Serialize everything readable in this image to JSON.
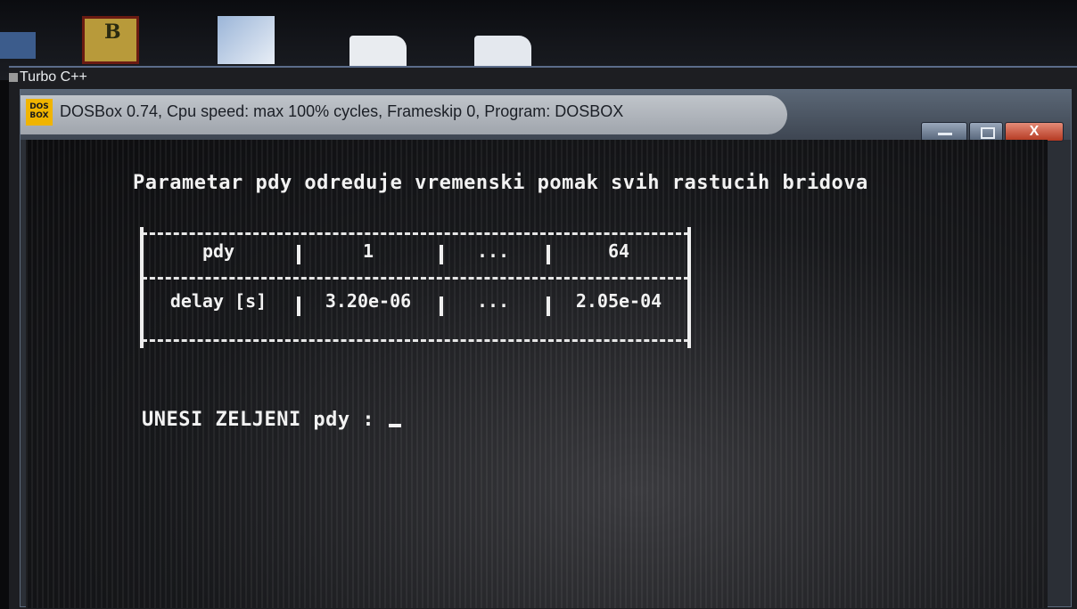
{
  "desktop": {
    "icons": [
      "game-icon",
      "image-icon",
      "document-icon",
      "document-icon"
    ]
  },
  "background_window": {
    "title": "Turbo C++"
  },
  "dosbox_window": {
    "title": "DOSBox 0.74, Cpu speed: max 100% cycles, Frameskip 0, Program:  DOSBOX",
    "icon_text": "DOS\nBOX",
    "close_label": "X"
  },
  "screen": {
    "heading": "Parametar pdy odreduje vremenski pomak svih rastucih bridova",
    "table": {
      "header": [
        "pdy",
        "1",
        "...",
        "64"
      ],
      "row": [
        "delay [s]",
        "3.20e-06",
        "...",
        "2.05e-04"
      ]
    },
    "prompt": "UNESI ZELJENI pdy : "
  },
  "colors": {
    "screen_text": "#f2f2f2",
    "screen_bg": "#17181b",
    "close_button": "#b53a22"
  }
}
